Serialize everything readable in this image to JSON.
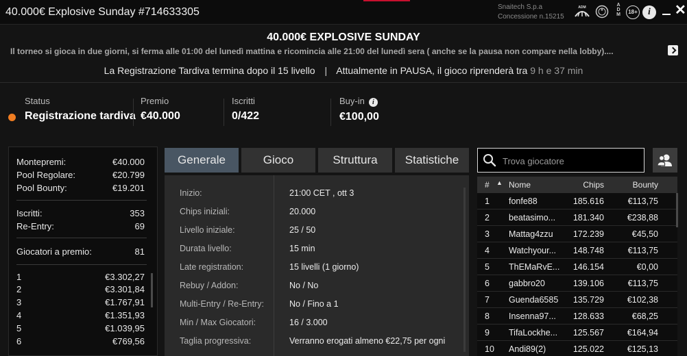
{
  "window": {
    "title": "40.000€ Explosive Sunday #714633305",
    "operator_line1": "Snaitech S.p.a",
    "operator_line2": "Concessione n.15215",
    "adm_logo_text": "ADM",
    "adm_vertical": [
      "A",
      "D",
      "M"
    ],
    "age_badge": "18+",
    "info_icon": "i",
    "close_icon": "✕"
  },
  "header": {
    "tournament_name": "40.000€ EXPLOSIVE SUNDAY",
    "description": "Il torneo si gioca in due giorni, si ferma alle 01:00 del lunedì mattina e ricomincia alle 21:00 del lunedì sera ( anche se la pausa non compare nella lobby)....",
    "late_reg_text": "La Registrazione Tardiva termina dopo il 15 livello",
    "separator": "|",
    "pause_text": "Attualmente in PAUSA, il gioco riprenderà tra",
    "resume_time": "9 h e 37 min"
  },
  "status_row": {
    "status_label": "Status",
    "status_value": "Registrazione tardiva",
    "status_color": "#f07d22",
    "prize_label": "Premio",
    "prize_value": "€40.000",
    "entries_label": "Iscritti",
    "entries_value": "0/422",
    "buyin_label": "Buy-in",
    "buyin_value": "€100,00",
    "buyin_info_icon": "i"
  },
  "prize_panel": {
    "summary": [
      {
        "label": "Montepremi:",
        "value": "€40.000"
      },
      {
        "label": "Pool Regolare:",
        "value": "€20.799"
      },
      {
        "label": "Pool Bounty:",
        "value": "€19.201"
      }
    ],
    "entries": [
      {
        "label": "Iscritti:",
        "value": "353"
      },
      {
        "label": "Re-Entry:",
        "value": "69"
      }
    ],
    "paid": {
      "label": "Giocatori a premio:",
      "value": "81"
    },
    "payouts": [
      {
        "place": "1",
        "amount": "€3.302,27"
      },
      {
        "place": "2",
        "amount": "€3.301,84"
      },
      {
        "place": "3",
        "amount": "€1.767,91"
      },
      {
        "place": "4",
        "amount": "€1.351,93"
      },
      {
        "place": "5",
        "amount": "€1.039,95"
      },
      {
        "place": "6",
        "amount": "€769,56"
      }
    ]
  },
  "tabs": [
    {
      "label": "Generale",
      "active": true
    },
    {
      "label": "Gioco",
      "active": false
    },
    {
      "label": "Struttura",
      "active": false
    },
    {
      "label": "Statistiche",
      "active": false
    }
  ],
  "details": [
    {
      "label": "Inizio:",
      "value": "21:00 CET , ott 3"
    },
    {
      "label": "Chips iniziali:",
      "value": "20.000"
    },
    {
      "label": "Livello iniziale:",
      "value": "25 / 50"
    },
    {
      "label": "Durata livello:",
      "value": "15 min"
    },
    {
      "label": "Late registration:",
      "value": "15 livelli (1 giorno)"
    },
    {
      "label": "Rebuy / Addon:",
      "value": "No / No"
    },
    {
      "label": "Multi-Entry / Re-Entry:",
      "value": "No / Fino a 1"
    },
    {
      "label": "Min / Max Giocatori:",
      "value": "16 / 3.000"
    },
    {
      "label": "Taglia progressiva:",
      "value": "Verranno erogati almeno €22,75 per ogni"
    }
  ],
  "search": {
    "placeholder": "Trova giocatore",
    "icon": "search-icon"
  },
  "players_table": {
    "headers": {
      "rank": "#",
      "name": "Nome",
      "chips": "Chips",
      "bounty": "Bounty"
    },
    "rows": [
      {
        "rank": "1",
        "name": "fonfe88",
        "chips": "185.616",
        "bounty": "€113,75"
      },
      {
        "rank": "2",
        "name": "beatasimo...",
        "chips": "181.340",
        "bounty": "€238,88"
      },
      {
        "rank": "3",
        "name": "Mattag4zzu",
        "chips": "172.239",
        "bounty": "€45,50"
      },
      {
        "rank": "4",
        "name": "Watchyour...",
        "chips": "148.748",
        "bounty": "€113,75"
      },
      {
        "rank": "5",
        "name": "ThEMaRvE...",
        "chips": "146.154",
        "bounty": "€0,00"
      },
      {
        "rank": "6",
        "name": "gabbro20",
        "chips": "139.106",
        "bounty": "€113,75"
      },
      {
        "rank": "7",
        "name": "Guenda6585",
        "chips": "135.729",
        "bounty": "€102,38"
      },
      {
        "rank": "8",
        "name": "Insenna97...",
        "chips": "128.633",
        "bounty": "€68,25"
      },
      {
        "rank": "9",
        "name": "TifaLockhe...",
        "chips": "125.567",
        "bounty": "€164,94"
      },
      {
        "rank": "10",
        "name": "Andi89(2)",
        "chips": "125.022",
        "bounty": "€125,13"
      }
    ]
  }
}
